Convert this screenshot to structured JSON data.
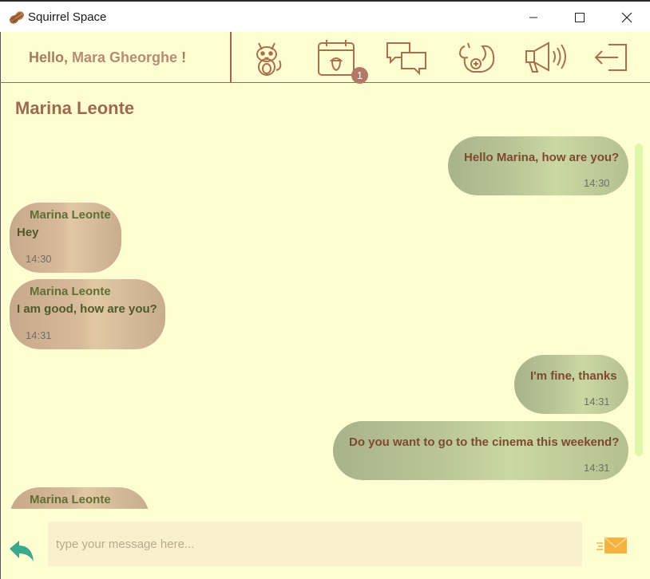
{
  "window": {
    "title": "Squirrel Space",
    "controls": [
      "minimize",
      "maximize",
      "close"
    ]
  },
  "header": {
    "greeting_prefix": "Hello,",
    "user_name": "Mara Gheorghe",
    "greeting_suffix": "!",
    "nav": [
      {
        "name": "profile",
        "icon": "squirrel-face-icon"
      },
      {
        "name": "events",
        "icon": "calendar-acorn-icon",
        "badge": "1"
      },
      {
        "name": "chats",
        "icon": "chat-bubbles-icon"
      },
      {
        "name": "find-friends",
        "icon": "squirrel-add-icon"
      },
      {
        "name": "announcements",
        "icon": "megaphone-icon"
      },
      {
        "name": "logout",
        "icon": "logout-icon"
      }
    ]
  },
  "chat": {
    "contact_name": "Marina Leonte",
    "messages": [
      {
        "direction": "sent",
        "text": "Hello Marina, how are you?",
        "time": "14:30"
      },
      {
        "direction": "received",
        "sender": "Marina Leonte",
        "text": "Hey",
        "time": "14:30"
      },
      {
        "direction": "received",
        "sender": "Marina Leonte",
        "text": "I am good, how are you?",
        "time": "14:31"
      },
      {
        "direction": "sent",
        "text": "I'm fine, thanks",
        "time": "14:31"
      },
      {
        "direction": "sent",
        "text": "Do you want to go to the cinema this weekend?",
        "time": "14:31"
      },
      {
        "direction": "received",
        "sender": "Marina Leonte",
        "text": "",
        "time": ""
      }
    ]
  },
  "composer": {
    "placeholder": "type your message here...",
    "value": ""
  },
  "colors": {
    "background": "#fffed2",
    "accent_brown": "#9c6a4e",
    "sent_bubble": "#c0cb98",
    "received_bubble": "#d8bb9a",
    "badge": "#b07a66",
    "reply_icon": "#3aa98d",
    "send_icon": "#f4b240"
  }
}
